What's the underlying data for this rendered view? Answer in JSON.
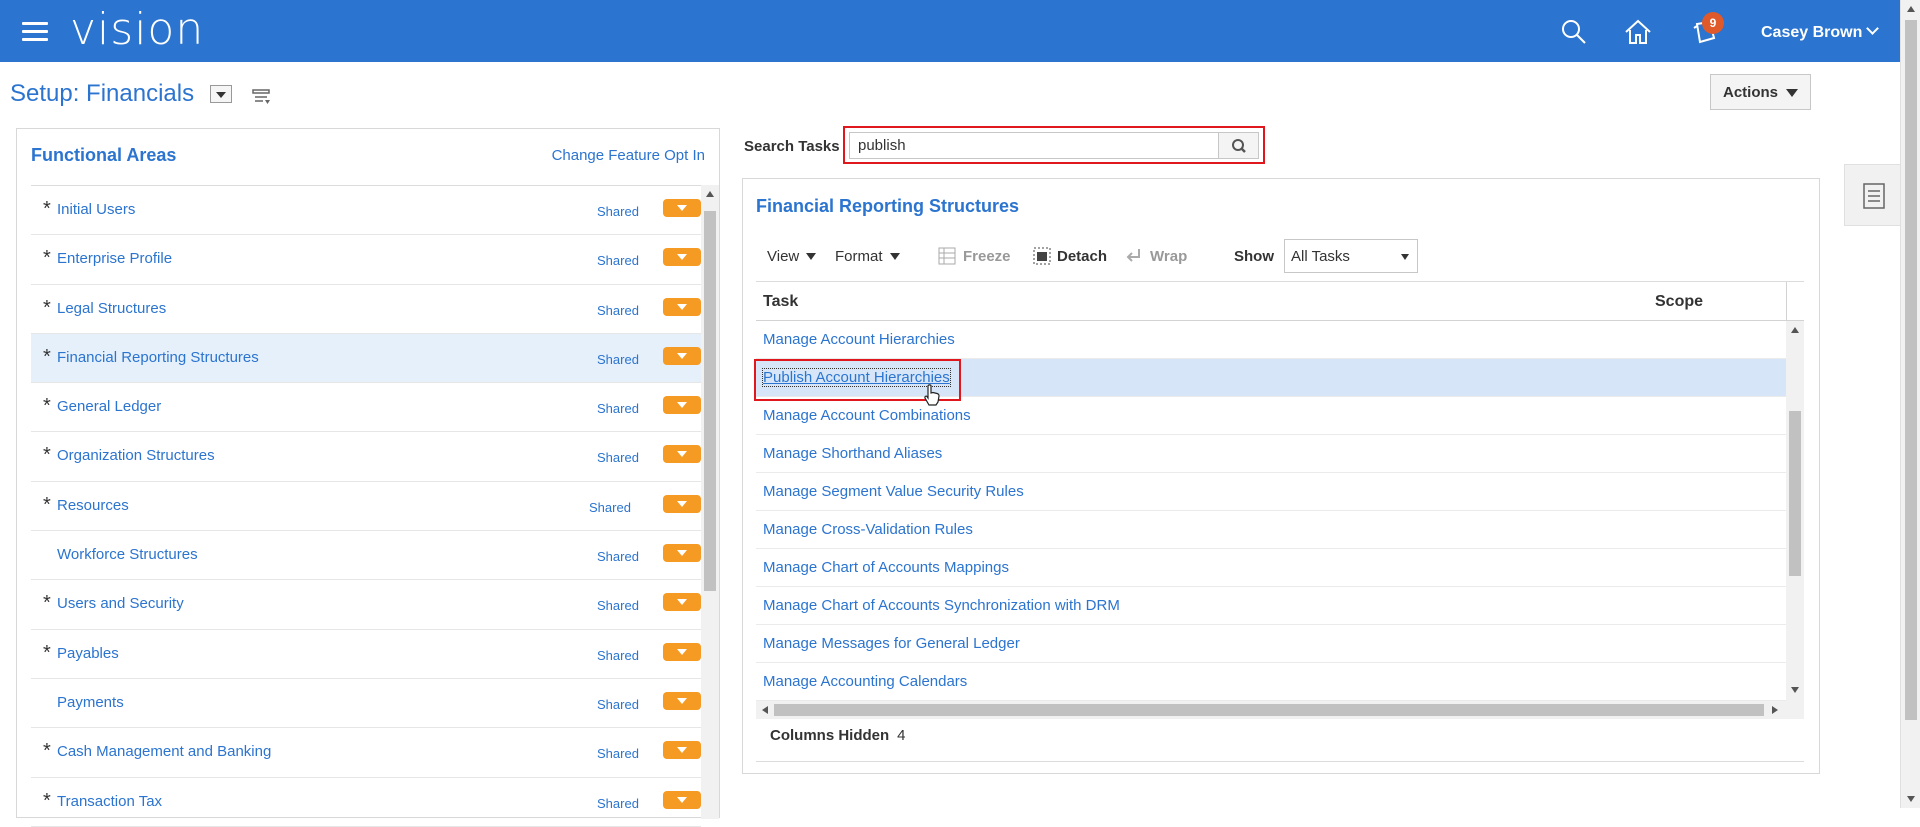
{
  "header": {
    "logo": "vision",
    "notification_count": "9",
    "user_name": "Casey Brown"
  },
  "page": {
    "title": "Setup: Financials",
    "actions_label": "Actions"
  },
  "functional_areas": {
    "title": "Functional Areas",
    "change_link": "Change Feature Opt In",
    "items": [
      {
        "name": "Initial Users",
        "required": "*",
        "status": "Shared"
      },
      {
        "name": "Enterprise Profile",
        "required": "*",
        "status": "Shared"
      },
      {
        "name": "Legal Structures",
        "required": "*",
        "status": "Shared"
      },
      {
        "name": "Financial Reporting Structures",
        "required": "*",
        "status": "Shared"
      },
      {
        "name": "General Ledger",
        "required": "*",
        "status": "Shared"
      },
      {
        "name": "Organization Structures",
        "required": "*",
        "status": "Shared"
      },
      {
        "name": "Resources",
        "required": "*",
        "status": "Shared"
      },
      {
        "name": "Workforce Structures",
        "required": "",
        "status": "Shared"
      },
      {
        "name": "Users and Security",
        "required": "*",
        "status": "Shared"
      },
      {
        "name": "Payables",
        "required": "*",
        "status": "Shared"
      },
      {
        "name": "Payments",
        "required": "",
        "status": "Shared"
      },
      {
        "name": "Cash Management and Banking",
        "required": "*",
        "status": "Shared"
      },
      {
        "name": "Transaction Tax",
        "required": "*",
        "status": "Shared"
      }
    ]
  },
  "search": {
    "label": "Search Tasks",
    "value": "publish"
  },
  "tasks_panel": {
    "title": "Financial Reporting Structures",
    "toolbar": {
      "view": "View",
      "format": "Format",
      "freeze": "Freeze",
      "detach": "Detach",
      "wrap": "Wrap",
      "show": "Show",
      "show_value": "All Tasks"
    },
    "columns": {
      "task": "Task",
      "scope": "Scope"
    },
    "rows": [
      "Manage Account Hierarchies",
      "Publish Account Hierarchies",
      "Manage Account Combinations",
      "Manage Shorthand Aliases",
      "Manage Segment Value Security Rules",
      "Manage Cross-Validation Rules",
      "Manage Chart of Accounts Mappings",
      "Manage Chart of Accounts Synchronization with DRM",
      "Manage Messages for General Ledger",
      "Manage Accounting Calendars"
    ],
    "columns_hidden_label": "Columns Hidden",
    "columns_hidden_count": "4"
  },
  "colors": {
    "brand_blue": "#2b74cf",
    "accent_orange": "#f59a23",
    "highlight_red": "#e1171e",
    "badge": "#e0592a"
  }
}
